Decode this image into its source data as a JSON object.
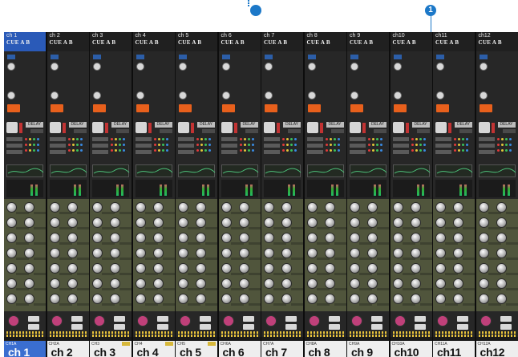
{
  "callouts": [
    {
      "label": "1"
    }
  ],
  "cue_label": "CUE A B",
  "delay_label": "DELAY",
  "strips": [
    {
      "name": "ch 1",
      "port": "CH1A",
      "label": "ch 1",
      "selected": true,
      "tag": false
    },
    {
      "name": "ch 2",
      "port": "CH2A",
      "label": "ch 2",
      "selected": false,
      "tag": false
    },
    {
      "name": "ch 3",
      "port": "CH3",
      "label": "ch 3",
      "selected": false,
      "tag": true
    },
    {
      "name": "ch 4",
      "port": "CH4",
      "label": "ch 4",
      "selected": false,
      "tag": true
    },
    {
      "name": "ch 5",
      "port": "CH5",
      "label": "ch 5",
      "selected": false,
      "tag": true
    },
    {
      "name": "ch 6",
      "port": "CH6A",
      "label": "ch 6",
      "selected": false,
      "tag": false
    },
    {
      "name": "ch 7",
      "port": "CH7A",
      "label": "ch 7",
      "selected": false,
      "tag": false
    },
    {
      "name": "ch 8",
      "port": "CH8A",
      "label": "ch 8",
      "selected": false,
      "tag": false
    },
    {
      "name": "ch 9",
      "port": "CH9A",
      "label": "ch 9",
      "selected": false,
      "tag": false
    },
    {
      "name": "ch10",
      "port": "CH10A",
      "label": "ch10",
      "selected": false,
      "tag": false
    },
    {
      "name": "ch11",
      "port": "CH11A",
      "label": "ch11",
      "selected": false,
      "tag": false
    },
    {
      "name": "ch12",
      "port": "CH12A",
      "label": "ch12",
      "selected": false,
      "tag": false
    }
  ]
}
